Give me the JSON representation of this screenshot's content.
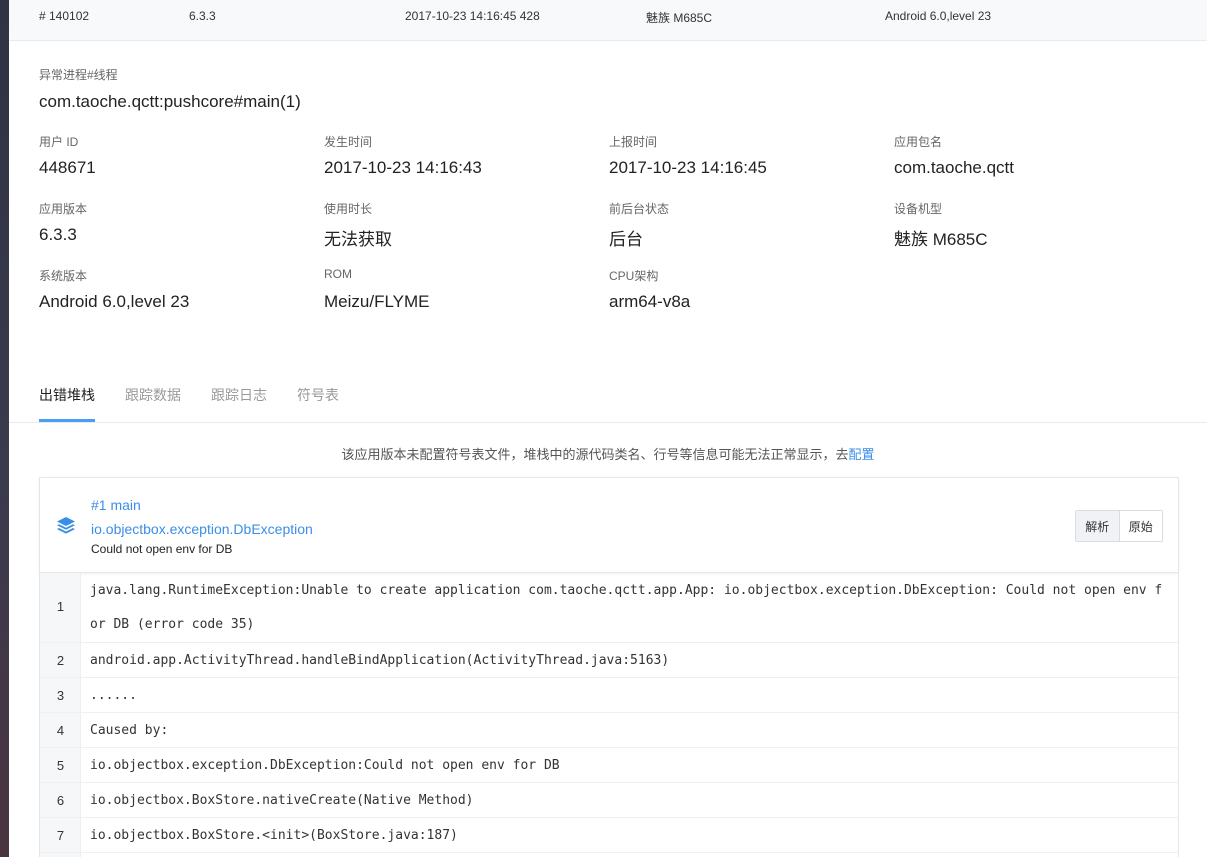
{
  "top_row": {
    "id": "# 140102",
    "version": "6.3.3",
    "time": "2017-10-23 14:16:45 428",
    "device": "魅族 M685C",
    "os": "Android 6.0,level 23"
  },
  "process": {
    "label": "异常进程#线程",
    "value": "com.taoche.qctt:pushcore#main(1)"
  },
  "details": [
    {
      "label": "用户 ID",
      "value": "448671"
    },
    {
      "label": "发生时间",
      "value": "2017-10-23 14:16:43"
    },
    {
      "label": "上报时间",
      "value": "2017-10-23 14:16:45"
    },
    {
      "label": "应用包名",
      "value": "com.taoche.qctt"
    },
    {
      "label": "应用版本",
      "value": "6.3.3"
    },
    {
      "label": "使用时长",
      "value": "无法获取"
    },
    {
      "label": "前后台状态",
      "value": "后台"
    },
    {
      "label": "设备机型",
      "value": "魅族 M685C"
    },
    {
      "label": "系统版本",
      "value": "Android 6.0,level 23"
    },
    {
      "label": "ROM",
      "value": "Meizu/FLYME"
    },
    {
      "label": "CPU架构",
      "value": "arm64-v8a"
    }
  ],
  "tabs": [
    {
      "label": "出错堆栈"
    },
    {
      "label": "跟踪数据"
    },
    {
      "label": "跟踪日志"
    },
    {
      "label": "符号表"
    }
  ],
  "notice": {
    "text": "该应用版本未配置符号表文件，堆栈中的源代码类名、行号等信息可能无法正常显示，去",
    "link": "配置"
  },
  "stack": {
    "thread": "#1 main",
    "exception": "io.objectbox.exception.DbException",
    "message": "Could not open env for DB",
    "buttons": {
      "parsed": "解析",
      "raw": "原始"
    },
    "icon": "layers-icon",
    "accent_color": "#3b8ee6"
  },
  "code_lines": [
    {
      "num": "1",
      "lines": [
        "java.lang.RuntimeException:Unable to create application com.taoche.qctt.app.App: io.objectbox.exception.DbException: Could not open env f",
        "or DB (error code 35)"
      ]
    },
    {
      "num": "2",
      "lines": [
        "android.app.ActivityThread.handleBindApplication(ActivityThread.java:5163)"
      ]
    },
    {
      "num": "3",
      "lines": [
        "......"
      ]
    },
    {
      "num": "4",
      "lines": [
        "Caused by:"
      ]
    },
    {
      "num": "5",
      "lines": [
        "io.objectbox.exception.DbException:Could not open env for DB"
      ]
    },
    {
      "num": "6",
      "lines": [
        "io.objectbox.BoxStore.nativeCreate(Native Method)"
      ]
    },
    {
      "num": "7",
      "lines": [
        "io.objectbox.BoxStore.<init>(BoxStore.java:187)"
      ]
    }
  ]
}
